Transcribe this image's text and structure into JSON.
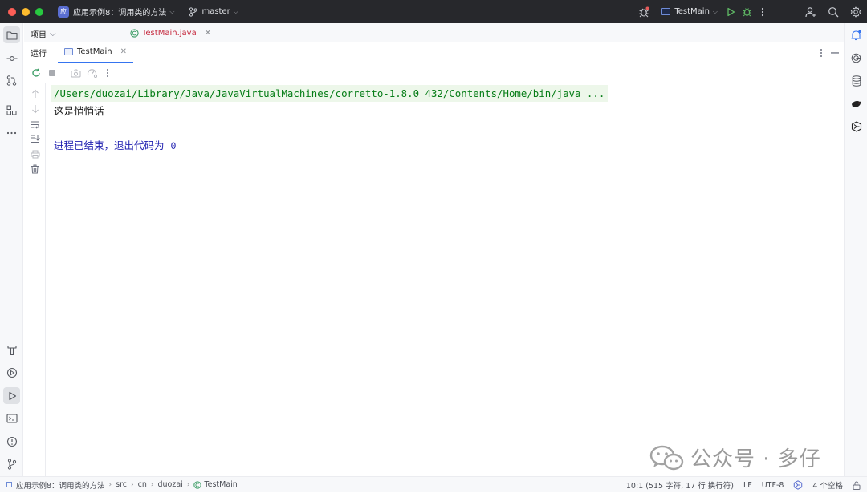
{
  "titlebar": {
    "project_badge": "应",
    "project_name": "应用示例8：调用类的方法",
    "branch": "master",
    "run_config": "TestMain"
  },
  "left_toolbar": {
    "icons": [
      "folder-icon",
      "commit-icon",
      "pull-request-icon",
      "structure-icon",
      "more-icon",
      "build-icon",
      "services-icon",
      "run-icon",
      "terminal-icon",
      "problems-icon",
      "git-icon"
    ]
  },
  "right_toolbar": {
    "icons": [
      "notifications-icon",
      "ai-assistant-icon",
      "database-icon",
      "plugin-icon",
      "kotlin-icon"
    ]
  },
  "project_panel": {
    "label": "项目"
  },
  "editor_tabs": [
    {
      "label": "TestMain.java"
    }
  ],
  "run_panel": {
    "title": "运行",
    "tab_label": "TestMain"
  },
  "console": {
    "command": "/Users/duozai/Library/Java/JavaVirtualMachines/corretto-1.8.0_432/Contents/Home/bin/java ...",
    "output_line": "这是悄悄话",
    "exit_text": "进程已结束，退出代码为",
    "exit_code": "0"
  },
  "watermark": {
    "text": "公众号 · 多仔"
  },
  "statusbar": {
    "breadcrumbs": [
      "应用示例8：调用类的方法",
      "src",
      "cn",
      "duozai",
      "TestMain"
    ],
    "position": "10:1 (515 字符, 17 行 换行符)",
    "line_separator": "LF",
    "encoding": "UTF-8",
    "indent": "4 个空格"
  },
  "colors": {
    "titlebar_bg": "#27282c",
    "accent": "#3574f0",
    "command_text": "#067d17",
    "command_bg": "#edf7ea",
    "exit_text": "#1f1fb0",
    "tab_file_text": "#c5283d"
  }
}
